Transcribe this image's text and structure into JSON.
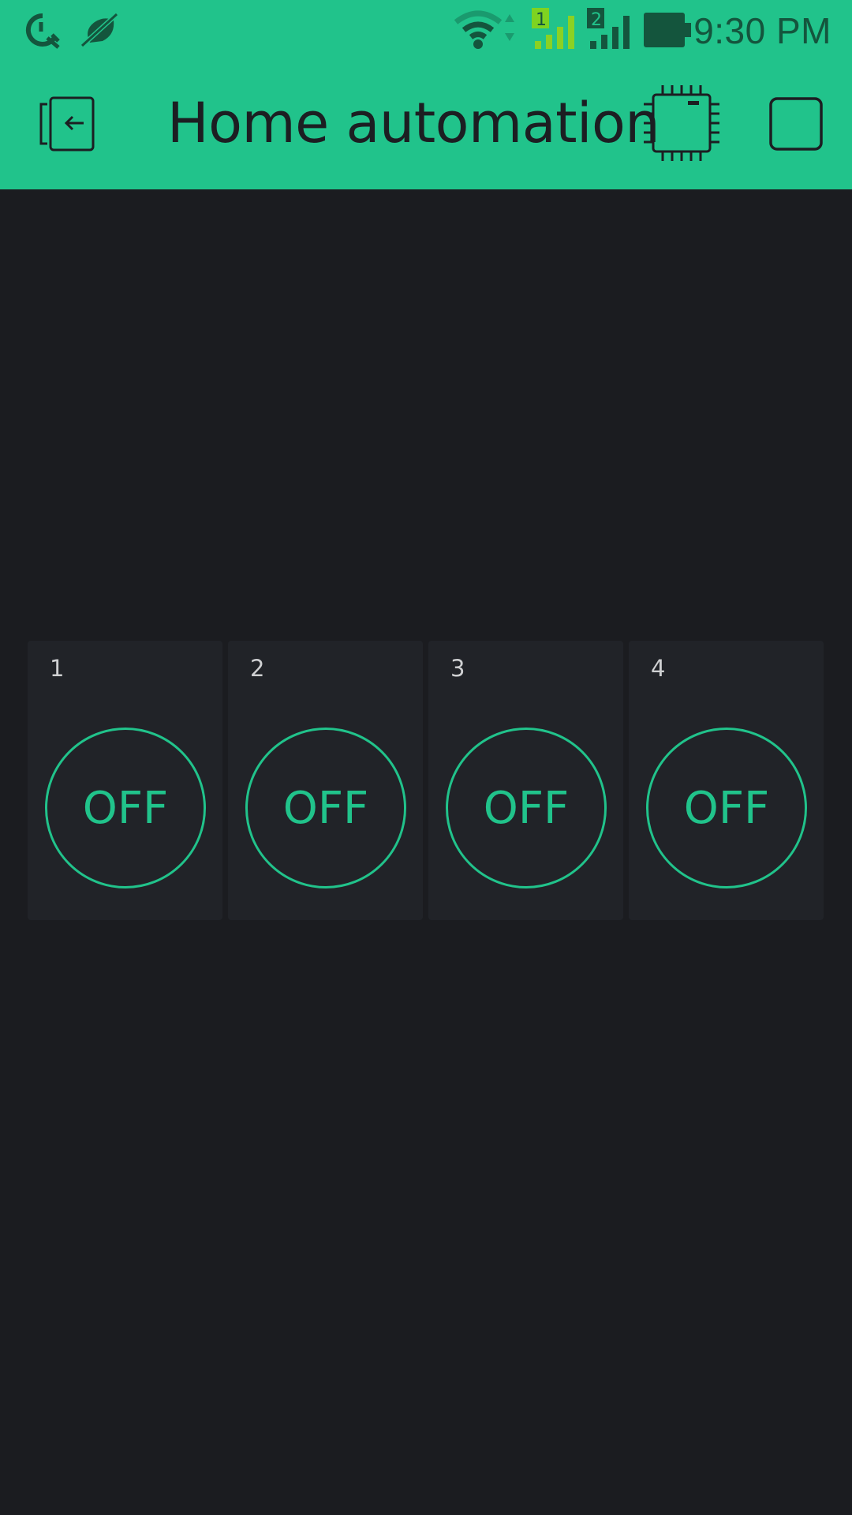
{
  "status_bar": {
    "time": "9:30 PM",
    "icons": [
      "data-saver-icon",
      "notifications-muted-icon",
      "wifi-icon",
      "signal-sim1-icon",
      "signal-sim2-icon",
      "battery-icon"
    ],
    "sim1_label": "1",
    "sim2_label": "2"
  },
  "app_bar": {
    "title": "Home automation",
    "left_icon": "exit-icon",
    "right_icons": [
      "device-chip-icon",
      "stop-icon"
    ]
  },
  "tiles": [
    {
      "label": "1",
      "button_text": "OFF"
    },
    {
      "label": "2",
      "button_text": "OFF"
    },
    {
      "label": "3",
      "button_text": "OFF"
    },
    {
      "label": "4",
      "button_text": "OFF"
    }
  ],
  "colors": {
    "accent": "#21c38b",
    "background": "#1b1c20",
    "tile_background": "#212328",
    "status_icon": "#14553d"
  }
}
